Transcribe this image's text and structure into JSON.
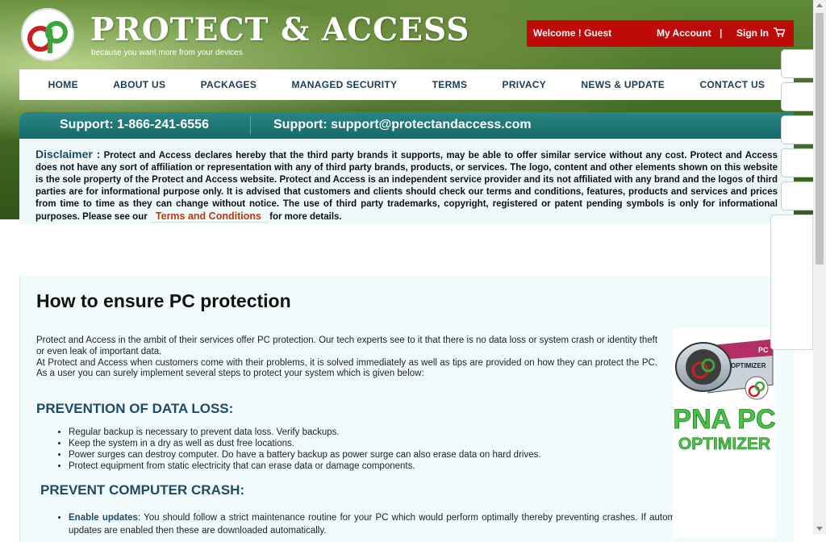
{
  "brand": {
    "title": "PROTECT & ACCESS",
    "tagline": "because you want more from your devices",
    "logo_icon": "ap-logo-icon"
  },
  "userbar": {
    "welcome": "Welcome !  Guest",
    "my_account": "My Account",
    "separator": "|",
    "sign_in": "Sign In",
    "cart_icon": "cart-icon"
  },
  "nav": {
    "items": [
      {
        "label": "HOME"
      },
      {
        "label": "ABOUT US"
      },
      {
        "label": "PACKAGES"
      },
      {
        "label": "MANAGED SECURITY"
      },
      {
        "label": "TERMS"
      },
      {
        "label": "PRIVACY"
      },
      {
        "label": "NEWS & UPDATE"
      },
      {
        "label": "CONTACT US"
      }
    ]
  },
  "support": {
    "phone": "Support: 1-866-241-6556",
    "email": "Support: support@protectandaccess.com"
  },
  "disclaimer": {
    "label": "Disclaimer :",
    "text": "Protect and Access declares hereby that the third party brands it supports, may be able to offer similar service without any cost. Protect and Access does not have any sort of affiliation or representation with any of third party brands, products, or services. The logo, content and other elements shown on this website is the sole property of the Protect and Access website. Protect and Access is an independent service provider and its not affiliated with any brand and the logos of third parties are for informational purpose only. It is advised that customers and clients should check our terms and conditions, features, products and services and prices from time to time as they can change without notice. The use of third party trademarks, copyright, registered or patent pending symbols is only for informational purposes. Please see our",
    "link": "Terms and Conditions",
    "after": "for more details."
  },
  "article": {
    "title": "How to ensure PC protection",
    "intro1": "Protect and Access in the ambit of their services offer PC protection. Our tech experts see to it that there is no data loss or system crash or identity theft or even leak of important data.",
    "intro2": " At Protect and Access when customers come with their problems, it is solved immediately as well as tips are provided on how they can protect the PC. As a user you can surely implement several steps to protect your system which is given below:",
    "section1_title": "PREVENTION OF DATA LOSS:",
    "section1_items": [
      "Regular backup is necessary to prevent data loss. Verify backups.",
      "Keep the system in a dry as well as dust free locations.",
      "Power surges can destroy computer. Do have a battery backup as power surge can also erase data on hard drives.",
      "Protect equipment from static electricity that can erase data or damage components."
    ],
    "section2_title": "PREVENT COMPUTER CRASH:",
    "section2_item_term": "Enable updates",
    "section2_item_text": ": You should follow a strict maintenance routine for your PC which would perform optimally thereby preventing crashes. If automatic updates are enabled then these are downloaded automatically."
  },
  "product": {
    "badge_line1": "PC",
    "badge_line2": "OPTIMIZER",
    "name_line1": "PNA PC",
    "name_line2": "OPTIMIZER"
  },
  "colors": {
    "accent_red": "#bf0a0a",
    "support_teal": "#166a69",
    "heading_blue": "#1e4b66",
    "link_orange": "#c0390f",
    "product_green": "#3fbf3f"
  }
}
